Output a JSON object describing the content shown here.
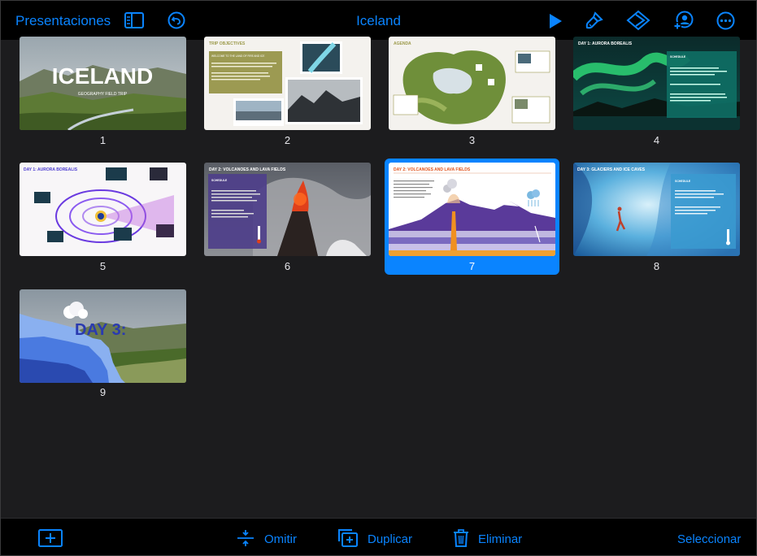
{
  "toolbar": {
    "back_label": "Presentaciones",
    "title": "Iceland"
  },
  "icons": {
    "sidebar": "sidebar-icon",
    "undo": "undo-icon",
    "play": "play-icon",
    "format": "paintbrush-icon",
    "animate": "animate-diamond-icon",
    "collaborate": "collaborate-icon",
    "more": "more-icon",
    "add_slide": "add-slide-icon"
  },
  "colors": {
    "accent": "#0a84ff",
    "background": "#1c1c1e",
    "bar": "#000000"
  },
  "slides": [
    {
      "number": "1",
      "title": "ICELAND",
      "subtitle": "GEOGRAPHY FIELD TRIP"
    },
    {
      "number": "2",
      "title": "TRIP OBJECTIVES",
      "subtitle": "WELCOME TO THE LAND OF FIRE AND ICE"
    },
    {
      "number": "3",
      "title": "AGENDA"
    },
    {
      "number": "4",
      "title": "DAY 1: AURORA BOREALIS",
      "subtitle": "SCHEDULE"
    },
    {
      "number": "5",
      "title": "DAY 1: AURORA BOREALIS"
    },
    {
      "number": "6",
      "title": "DAY 2: VOLCANOES AND LAVA FIELDS",
      "subtitle": "SCHEDULE"
    },
    {
      "number": "7",
      "title": "DAY 2: VOLCANOES AND LAVA FIELDS",
      "selected": true
    },
    {
      "number": "8",
      "title": "DAY 3: GLACIERS AND ICE CAVES",
      "subtitle": "SCHEDULE"
    },
    {
      "number": "9",
      "title": "DAY 3:"
    }
  ],
  "bottom": {
    "skip_label": "Omitir",
    "duplicate_label": "Duplicar",
    "delete_label": "Eliminar",
    "select_label": "Seleccionar"
  }
}
